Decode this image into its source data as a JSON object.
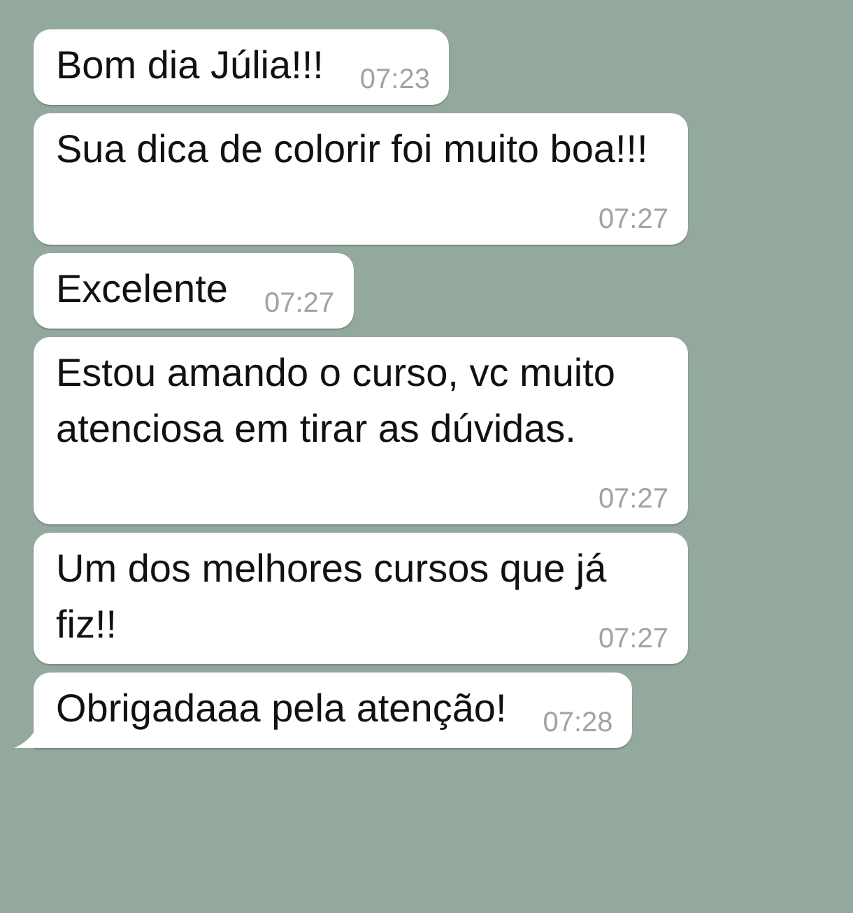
{
  "messages": [
    {
      "text": "Bom dia Júlia!!!",
      "time": "07:23",
      "tail": false
    },
    {
      "text": "Sua dica de colorir foi muito boa!!!",
      "time": "07:27",
      "tail": false
    },
    {
      "text": "Excelente",
      "time": "07:27",
      "tail": false
    },
    {
      "text": "Estou amando o curso, vc muito atenciosa em tirar as dúvidas.",
      "time": "07:27",
      "tail": false
    },
    {
      "text": "Um dos melhores cursos que já fiz!!",
      "time": "07:27",
      "tail": false
    },
    {
      "text": "Obrigadaaa pela atenção!",
      "time": "07:28",
      "tail": true
    }
  ]
}
